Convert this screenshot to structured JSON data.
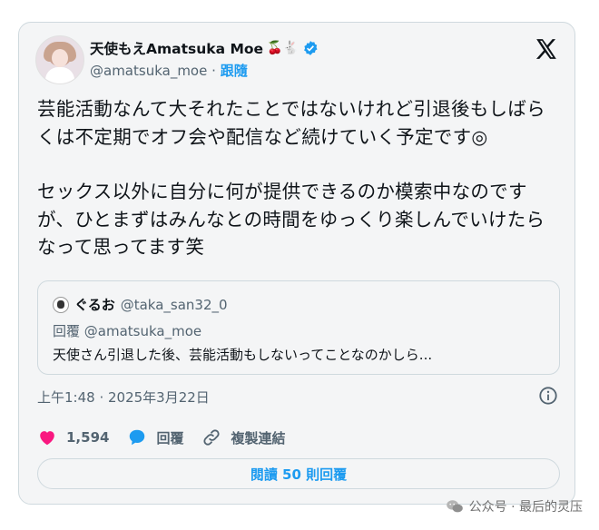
{
  "post": {
    "display_name": "天使もえAmatsuka Moe",
    "name_emojis": "🍒🐇",
    "handle": "@amatsuka_moe",
    "separator": "·",
    "follow_label": "跟隨",
    "text_paragraph_1": "芸能活動なんて大それたことではないけれど引退後もしばらくは不定期でオフ会や配信など続けていく予定です◎",
    "text_paragraph_2": "セックス以外に自分に何が提供できるのか模索中なのですが、ひとまずはみんなとの時間をゆっくり楽しんでいけたらなって思ってます笑",
    "timestamp": "上午1:48 · 2025年3月22日"
  },
  "quote": {
    "name": "ぐるお",
    "handle": "@taka_san32_0",
    "reply_label": "回覆 @amatsuka_moe",
    "text": "天使さん引退した後、芸能活動もしないってことなのかしら..."
  },
  "actions": {
    "likes": "1,594",
    "reply_label": "回覆",
    "copy_link_label": "複製連結"
  },
  "read_replies_label": "閱讀 50 則回覆",
  "watermark": "公众号 · 最后的灵压",
  "colors": {
    "accent": "#1d9bf0",
    "like": "#f91880",
    "verified": "#1d9bf0"
  },
  "icons": [
    "verified-badge-icon",
    "x-logo-icon",
    "info-icon",
    "heart-icon",
    "reply-bubble-icon",
    "link-icon",
    "wechat-icon"
  ]
}
